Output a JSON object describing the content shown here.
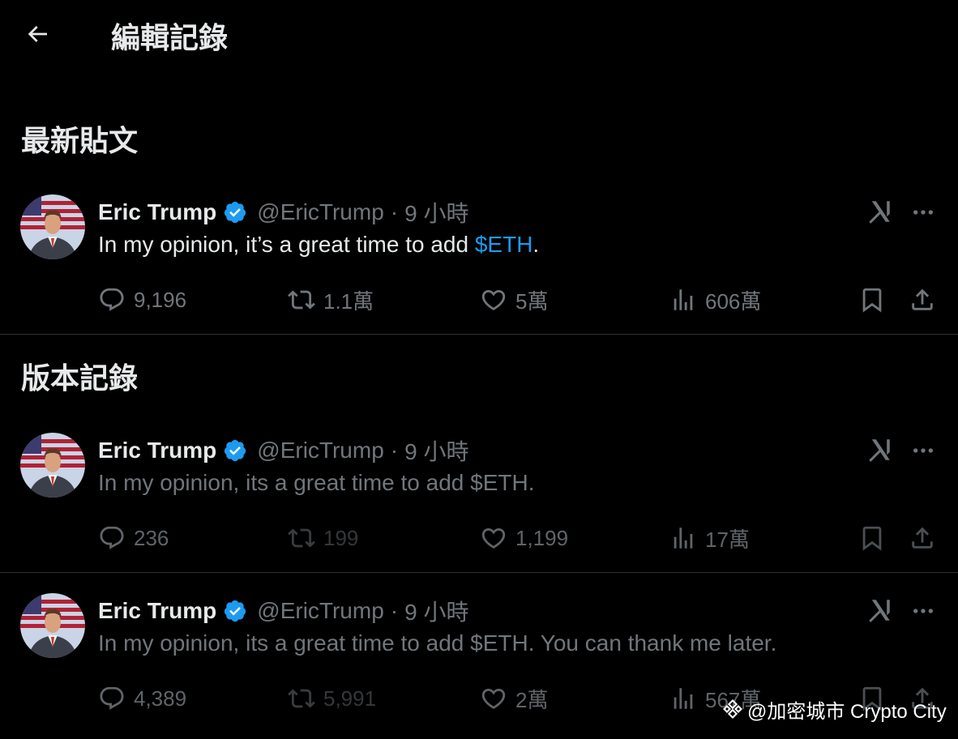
{
  "header": {
    "title": "編輯記錄"
  },
  "sections": {
    "latest": "最新貼文",
    "history": "版本記錄"
  },
  "posts": [
    {
      "author": "Eric Trump",
      "handle": "@EricTrump",
      "time": "9 小時",
      "text_before": "In my opinion, it’s a great time to add ",
      "cashtag": "$ETH",
      "text_after": ".",
      "replies": "9,196",
      "reposts": "1.1萬",
      "likes": "5萬",
      "views": "606萬"
    },
    {
      "author": "Eric Trump",
      "handle": "@EricTrump",
      "time": "9 小時",
      "text": "In my opinion, its a great time to add $ETH.",
      "replies": "236",
      "reposts": "199",
      "likes": "1,199",
      "views": "17萬"
    },
    {
      "author": "Eric Trump",
      "handle": "@EricTrump",
      "time": "9 小時",
      "text": "In my opinion, its a great time to add $ETH. You can thank me later.",
      "replies": "4,389",
      "reposts": "5,991",
      "likes": "2萬",
      "views": "567萬"
    }
  ],
  "separator": "·",
  "watermark": "@加密城市 Crypto City",
  "colors": {
    "background": "#000000",
    "accent": "#1d9bf0",
    "muted": "#71767b",
    "text": "#e7e9ea",
    "divider": "#2f3336"
  },
  "icons": [
    "back-arrow-icon",
    "verified-badge-icon",
    "grok-icon",
    "more-icon",
    "reply-icon",
    "repost-icon",
    "like-icon",
    "views-icon",
    "bookmark-icon",
    "share-icon"
  ]
}
